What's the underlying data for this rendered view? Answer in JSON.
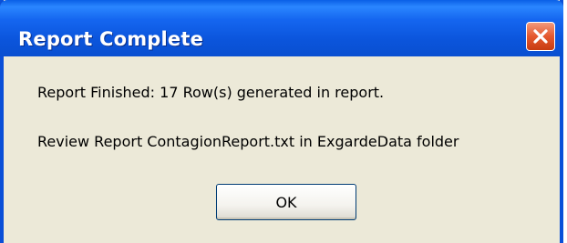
{
  "window": {
    "title": "Report Complete",
    "close_icon": "close-icon"
  },
  "dialog": {
    "message_line_1": "Report Finished: 17 Row(s) generated in report.",
    "message_line_2": "Review Report ContagionReport.txt in ExgardeData folder",
    "ok_label": "OK"
  },
  "colors": {
    "titlebar": "#0a4fd8",
    "close_button": "#e5582e",
    "dialog_background": "#ece9d8"
  }
}
